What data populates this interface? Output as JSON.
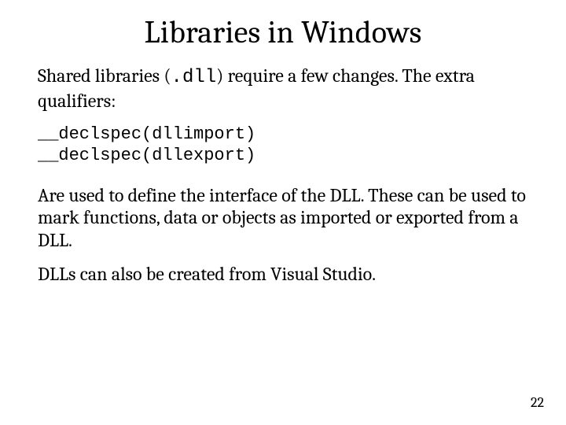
{
  "slide": {
    "title": "Libraries in Windows",
    "para1_pre": "Shared libraries (",
    "para1_code": ".dll",
    "para1_post": ") require a few changes. The extra qualifiers:",
    "code_line1": "__declspec(dllimport)",
    "code_line2": "__declspec(dllexport)",
    "para2": "Are used to define the interface of the DLL. These can be used to mark functions, data or objects as imported or exported from a DLL.",
    "para3": "DLLs can also be created from Visual Studio.",
    "page_number": "22"
  }
}
